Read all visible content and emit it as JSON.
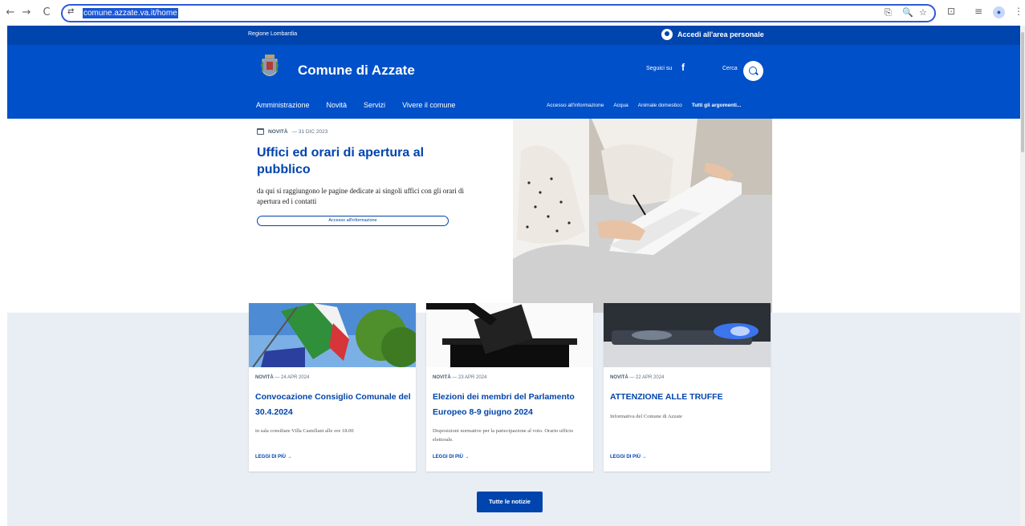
{
  "browser": {
    "url": "comune.azzate.va.it/home",
    "nav_back": "←",
    "nav_forward": "→",
    "nav_reload": "C",
    "tune_glyph": "⇄",
    "omni_icons": [
      "⎘",
      "🔍",
      "☆"
    ],
    "ext_icons": [
      "⊡",
      "≡"
    ],
    "profile_glyph": "●"
  },
  "site": {
    "region": "Regione Lombardia",
    "login": "Accedi all'area personale",
    "brand": "Comune di Azzate",
    "social_label": "Seguici su",
    "facebook_glyph": "f",
    "search_label": "Cerca",
    "main_nav": [
      "Amministrazione",
      "Novità",
      "Servizi",
      "Vivere il comune"
    ],
    "topics": [
      "Accesso all'informazione",
      "Acqua",
      "Animale domestico",
      "Tutti gli argomenti..."
    ]
  },
  "hero": {
    "category": "NOVITÀ",
    "date": "— 31 DIC 2023",
    "title": "Uffici ed orari di apertura al pubblico",
    "description": "da qui si raggiungono le pagine dedicate ai singoli uffici con gli orari di apertura ed i contatti",
    "button": "Accesso all'informazione"
  },
  "cards": [
    {
      "category": "NOVITÀ",
      "date": "— 24 APR 2024",
      "title": "Convocazione Consiglio Comunale del 30.4.2024",
      "description": "in sala consiliare Villa Castellani alle ore 18.00",
      "more": "LEGGI DI PIÙ →"
    },
    {
      "category": "NOVITÀ",
      "date": "— 23 APR 2024",
      "title": "Elezioni dei membri del Parlamento Europeo 8-9 giugno 2024",
      "description": "Disposizioni normative per la partecipazione al voto. Orario ufficio elettorale.",
      "more": "LEGGI DI PIÙ →"
    },
    {
      "category": "NOVITÀ",
      "date": "— 22 APR 2024",
      "title": "ATTENZIONE ALLE TRUFFE",
      "description": "Informativa del Comune di Azzate",
      "more": "LEGGI DI PIÙ →"
    }
  ],
  "all_news": "Tutte le notizie",
  "colors": {
    "brand_blue": "#0050c9",
    "topbar_blue": "#0044ad",
    "section_bg": "#e9edf4"
  }
}
